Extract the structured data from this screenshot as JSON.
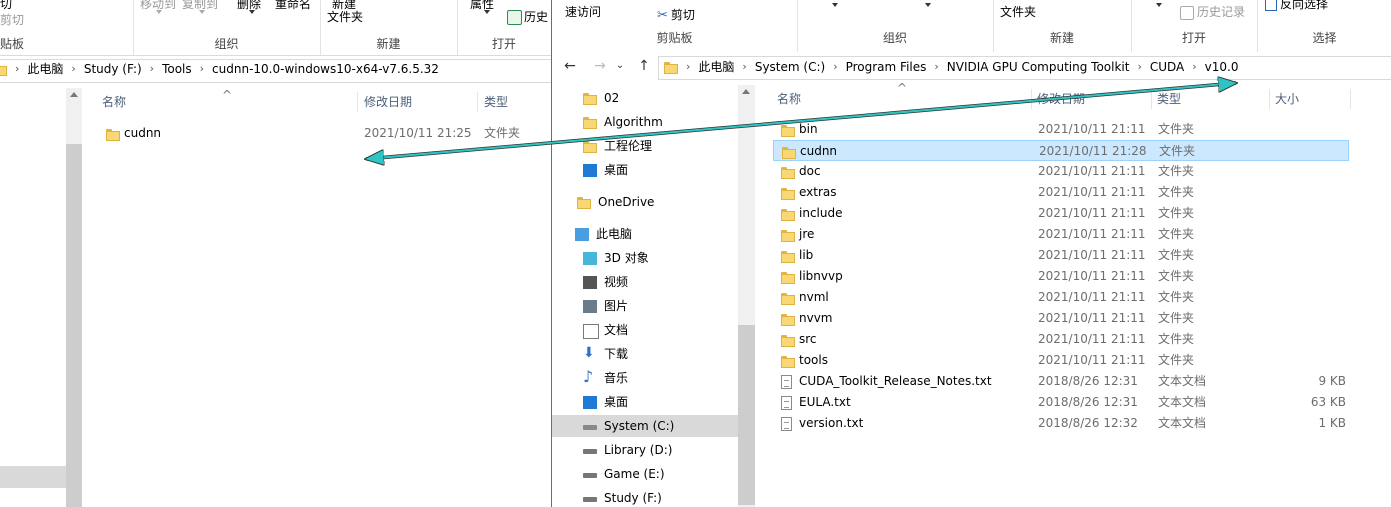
{
  "left_window": {
    "ribbon": {
      "cut_label": "剪切",
      "clipboard_group": "贴板",
      "move_to_label": "移动到",
      "copy_to_label": "复制到",
      "delete_label": "删除",
      "rename_label": "重命名",
      "organize_group": "组织",
      "new_item_label": "新建",
      "new_folder_label": "文件夹",
      "new_group": "新建",
      "properties_label": "属性",
      "history_label": "历史",
      "open_group": "打开"
    },
    "breadcrumb": [
      "此电脑",
      "Study (F:)",
      "Tools",
      "cudnn-10.0-windows10-x64-v7.6.5.32"
    ],
    "columns": {
      "name": "名称",
      "date": "修改日期",
      "type": "类型"
    },
    "files": [
      {
        "name": "cudnn",
        "date": "2021/10/11 21:25",
        "type": "文件夹",
        "icon": "folder-icon"
      }
    ]
  },
  "right_window": {
    "ribbon": {
      "quick_access_label": "速访问",
      "cut_label": "剪切",
      "clipboard_group": "剪贴板",
      "organize_group": "组织",
      "new_folder_label": "文件夹",
      "new_group": "新建",
      "history_label": "历史记录",
      "open_group": "打开",
      "invert_select_label": "反向选择",
      "select_group": "选择"
    },
    "breadcrumb": [
      "此电脑",
      "System (C:)",
      "Program Files",
      "NVIDIA GPU Computing Toolkit",
      "CUDA",
      "v10.0"
    ],
    "nav_items": [
      {
        "label": "02",
        "icon": "folder-icon"
      },
      {
        "label": "Algorithm",
        "icon": "folder-icon"
      },
      {
        "label": "工程伦理",
        "icon": "folder-icon"
      },
      {
        "label": "桌面",
        "icon": "desktop-icon"
      },
      {
        "label": "OneDrive",
        "icon": "onedrive-icon"
      },
      {
        "label": "此电脑",
        "icon": "this-pc-icon"
      },
      {
        "label": "3D 对象",
        "icon": "3d-objects-icon"
      },
      {
        "label": "视频",
        "icon": "videos-icon"
      },
      {
        "label": "图片",
        "icon": "pictures-icon"
      },
      {
        "label": "文档",
        "icon": "documents-icon"
      },
      {
        "label": "下载",
        "icon": "downloads-icon"
      },
      {
        "label": "音乐",
        "icon": "music-icon"
      },
      {
        "label": "桌面",
        "icon": "desktop-icon"
      },
      {
        "label": "System (C:)",
        "icon": "system-drive-icon"
      },
      {
        "label": "Library (D:)",
        "icon": "drive-icon"
      },
      {
        "label": "Game (E:)",
        "icon": "drive-icon"
      },
      {
        "label": "Study (F:)",
        "icon": "drive-icon"
      }
    ],
    "selected_nav": "System (C:)",
    "columns": {
      "name": "名称",
      "date": "修改日期",
      "type": "类型",
      "size": "大小"
    },
    "files": [
      {
        "name": "bin",
        "date": "2021/10/11 21:11",
        "type": "文件夹",
        "size": "",
        "icon": "folder-icon"
      },
      {
        "name": "cudnn",
        "date": "2021/10/11 21:28",
        "type": "文件夹",
        "size": "",
        "icon": "folder-icon"
      },
      {
        "name": "doc",
        "date": "2021/10/11 21:11",
        "type": "文件夹",
        "size": "",
        "icon": "folder-icon"
      },
      {
        "name": "extras",
        "date": "2021/10/11 21:11",
        "type": "文件夹",
        "size": "",
        "icon": "folder-icon"
      },
      {
        "name": "include",
        "date": "2021/10/11 21:11",
        "type": "文件夹",
        "size": "",
        "icon": "folder-icon"
      },
      {
        "name": "jre",
        "date": "2021/10/11 21:11",
        "type": "文件夹",
        "size": "",
        "icon": "folder-icon"
      },
      {
        "name": "lib",
        "date": "2021/10/11 21:11",
        "type": "文件夹",
        "size": "",
        "icon": "folder-icon"
      },
      {
        "name": "libnvvp",
        "date": "2021/10/11 21:11",
        "type": "文件夹",
        "size": "",
        "icon": "folder-icon"
      },
      {
        "name": "nvml",
        "date": "2021/10/11 21:11",
        "type": "文件夹",
        "size": "",
        "icon": "folder-icon"
      },
      {
        "name": "nvvm",
        "date": "2021/10/11 21:11",
        "type": "文件夹",
        "size": "",
        "icon": "folder-icon"
      },
      {
        "name": "src",
        "date": "2021/10/11 21:11",
        "type": "文件夹",
        "size": "",
        "icon": "folder-icon"
      },
      {
        "name": "tools",
        "date": "2021/10/11 21:11",
        "type": "文件夹",
        "size": "",
        "icon": "folder-icon"
      },
      {
        "name": "CUDA_Toolkit_Release_Notes.txt",
        "date": "2018/8/26 12:31",
        "type": "文本文档",
        "size": "9 KB",
        "icon": "text-file-icon"
      },
      {
        "name": "EULA.txt",
        "date": "2018/8/26 12:31",
        "type": "文本文档",
        "size": "63 KB",
        "icon": "text-file-icon"
      },
      {
        "name": "version.txt",
        "date": "2018/8/26 12:32",
        "type": "文本文档",
        "size": "1 KB",
        "icon": "text-file-icon"
      }
    ],
    "selected_file": "cudnn"
  },
  "colors": {
    "annotation_arrow": "#2ec4c4",
    "selection": "#cce8ff",
    "window_border": "#2b79d0"
  }
}
